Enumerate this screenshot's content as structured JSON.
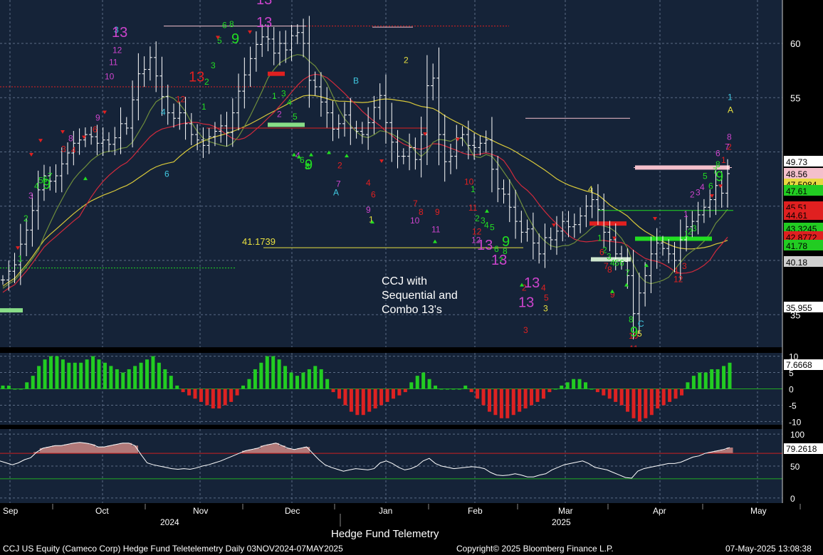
{
  "colors": {
    "panel_bg": "#152338",
    "grid": "#5a6b84",
    "bars": "#ffffff",
    "ma_short": "#6f8e3c",
    "ma_mid": "#d22a3c",
    "ma_long": "#d9c93a",
    "setup_green": "#22dd22",
    "setup_magenta": "#cc44cc",
    "count_red": "#e02020",
    "count_yellow": "#e8e040",
    "count_cyan": "#40c8e0",
    "hist_pos": "#22cc22",
    "hist_neg": "#dd2222",
    "rsi_line": "#ffffff",
    "rsi_fill": "#b07878",
    "rsi_upper": "#cc2020",
    "rsi_lower": "#22aa22"
  },
  "annotation": {
    "line1": "CCJ with",
    "line2": "Sequential and",
    "line3": "Combo 13's"
  },
  "footer": {
    "center_title": "Hedge Fund Telemetry",
    "left": "CCJ US Equity (Cameco Corp) Hedge Fund Teletelemetry  Daily 03NOV2024-07MAY2025",
    "copyright": "Copyright© 2025 Bloomberg Finance L.P.",
    "timestamp": "07-May-2025 13:08:38"
  },
  "chart_data": [
    {
      "type": "bar",
      "subtype": "ohlc",
      "ticker": "CCJ US Equity",
      "ylim": [
        32,
        64
      ],
      "yticks": [
        35,
        40,
        45,
        50,
        55,
        60
      ],
      "ytick_labels": [
        "35",
        "",
        "",
        "",
        "55",
        "60"
      ],
      "x_month_labels": [
        "Sep",
        "Oct",
        "Nov",
        "Dec",
        "Jan",
        "Feb",
        "Mar",
        "Apr",
        "May"
      ],
      "x_year_labels": [
        "2024",
        "2025"
      ],
      "close_series": [
        38.2,
        39.0,
        39.6,
        41.5,
        42.8,
        44.6,
        46.5,
        47.8,
        47.3,
        47.8,
        48.9,
        49.9,
        50.8,
        51.1,
        51.6,
        51.4,
        50.8,
        51.1,
        50.7,
        51.3,
        52.6,
        52.2,
        54.8,
        57.2,
        57.6,
        58.7,
        57.0,
        55.1,
        53.6,
        53.1,
        53.6,
        52.6,
        51.6,
        51.1,
        50.6,
        51.4,
        51.9,
        52.4,
        51.8,
        53.6,
        55.6,
        57.1,
        58.6,
        59.9,
        60.6,
        60.4,
        59.1,
        60.0,
        59.4,
        60.7,
        61.0,
        60.0,
        56.6,
        56.0,
        54.6,
        53.6,
        52.1,
        52.6,
        53.4,
        52.2,
        51.9,
        51.6,
        52.7,
        54.1,
        55.2,
        52.7,
        50.9,
        49.6,
        49.6,
        50.4,
        49.3,
        51.6,
        56.1,
        56.8,
        51.6,
        49.1,
        49.6,
        51.3,
        51.6,
        50.6,
        50.4,
        50.8,
        51.1,
        48.4,
        46.6,
        46.1,
        44.9,
        43.6,
        42.6,
        42.9,
        41.6,
        40.6,
        42.1,
        41.9,
        42.7,
        43.6,
        43.1,
        43.3,
        44.1,
        45.0,
        45.6,
        44.7,
        42.6,
        41.9,
        40.6,
        39.9,
        38.6,
        35.1,
        37.0,
        38.6,
        40.6,
        41.6,
        41.1,
        40.6,
        40.0,
        41.9,
        43.1,
        43.6,
        44.2,
        44.9,
        45.6,
        46.9,
        46.2,
        48.0
      ],
      "annotations": [
        {
          "text": "41.1739",
          "kind": "level_label",
          "value": 41.17
        },
        {
          "text": "13",
          "kind": "sequential_13",
          "where": "Nov peak"
        },
        {
          "text": "13",
          "kind": "sequential_13",
          "where": "Feb low"
        },
        {
          "text": "13",
          "kind": "combo_13",
          "where": "Feb low"
        },
        {
          "text": "9",
          "kind": "setup_9",
          "where": "Sep"
        },
        {
          "text": "9",
          "kind": "setup_9",
          "where": "Nov"
        },
        {
          "text": "9",
          "kind": "setup_9",
          "where": "Dec"
        },
        {
          "text": "9",
          "kind": "setup_9",
          "where": "Apr low"
        },
        {
          "text": "9",
          "kind": "setup_9",
          "where": "Apr high"
        },
        {
          "text": "11",
          "kind": "count_label",
          "where": "Apr low"
        },
        {
          "text": "12",
          "kind": "count_label",
          "where": "Apr"
        },
        {
          "text": "C",
          "kind": "letter_label",
          "where": "Apr low"
        },
        {
          "text": "A",
          "kind": "letter_label",
          "where": "Dec"
        },
        {
          "text": "B",
          "kind": "letter_label",
          "where": "Dec"
        },
        {
          "text": "A",
          "kind": "letter_label",
          "where": "May"
        }
      ],
      "right_labels": [
        {
          "value": "49.73",
          "color": "#ffffff"
        },
        {
          "value": "48.56",
          "color": "#f4c0cc"
        },
        {
          "value": "47.5084",
          "color": "#e8d840"
        },
        {
          "value": "47.61",
          "color": "#22cc22"
        },
        {
          "value": "45.51",
          "color": "#e02020"
        },
        {
          "value": "44.61",
          "color": "#e02020"
        },
        {
          "value": "43.3245",
          "color": "#22cc22"
        },
        {
          "value": "42.8772",
          "color": "#e02020"
        },
        {
          "value": "41.78",
          "color": "#22cc22"
        },
        {
          "value": "40.18",
          "color": "#d0d0d0"
        },
        {
          "value": "35.955",
          "color": "#ffffff"
        }
      ]
    },
    {
      "type": "bar",
      "subtype": "histogram",
      "ylim": [
        -11,
        11
      ],
      "yticks": [
        10,
        5,
        0,
        -5,
        -10
      ],
      "ytick_labels": [
        "10",
        "5",
        "0",
        "-5",
        "-10"
      ],
      "last_value_label": "7.6668",
      "values": [
        1,
        1,
        0,
        0,
        2,
        4,
        7,
        9,
        10,
        10,
        9,
        8,
        8,
        8,
        9,
        10,
        9,
        8,
        7,
        6,
        5,
        6,
        7,
        8,
        9,
        10,
        8,
        6,
        4,
        1,
        -1,
        -2,
        -3,
        -4,
        -5,
        -6,
        -6,
        -5,
        -4,
        -2,
        1,
        3,
        6,
        8,
        10,
        10,
        9,
        7,
        5,
        4,
        5,
        6,
        7,
        6,
        3,
        -1,
        -3,
        -5,
        -7,
        -8,
        -8,
        -7,
        -6,
        -5,
        -4,
        -3,
        -2,
        -1,
        2,
        4,
        5,
        3,
        1,
        0,
        0,
        0,
        0,
        1,
        -1,
        -3,
        -5,
        -7,
        -8,
        -9,
        -9,
        -8,
        -7,
        -6,
        -5,
        -4,
        -3,
        -1,
        0,
        1,
        2,
        3,
        3,
        2,
        0,
        -1,
        -2,
        -3,
        -4,
        -5,
        -7,
        -9,
        -10,
        -9,
        -8,
        -6,
        -5,
        -4,
        -3,
        -2,
        2,
        4,
        5,
        5,
        6,
        6,
        7,
        8
      ]
    },
    {
      "type": "line",
      "subtype": "oscillator",
      "ylim": [
        -8,
        108
      ],
      "yticks": [
        100,
        50,
        0
      ],
      "ytick_labels": [
        "100",
        "50",
        "0"
      ],
      "upper_level": 70,
      "lower_level": 30,
      "last_value_label": "79.2618",
      "values": [
        58,
        55,
        52,
        55,
        60,
        63,
        72,
        78,
        80,
        82,
        82,
        84,
        86,
        87,
        86,
        84,
        80,
        80,
        82,
        84,
        86,
        86,
        82,
        68,
        55,
        52,
        50,
        48,
        46,
        45,
        46,
        45,
        47,
        50,
        52,
        55,
        58,
        62,
        66,
        70,
        74,
        76,
        78,
        82,
        84,
        86,
        82,
        78,
        76,
        78,
        80,
        70,
        60,
        52,
        48,
        45,
        42,
        44,
        46,
        45,
        44,
        46,
        55,
        58,
        54,
        48,
        44,
        46,
        50,
        58,
        62,
        54,
        50,
        48,
        46,
        47,
        48,
        49,
        48,
        46,
        40,
        36,
        35,
        36,
        38,
        36,
        33,
        33,
        36,
        38,
        44,
        48,
        52,
        54,
        56,
        58,
        54,
        48,
        46,
        44,
        40,
        36,
        32,
        31,
        42,
        46,
        48,
        50,
        52,
        54,
        54,
        56,
        60,
        64,
        66,
        70,
        72,
        74,
        76,
        79
      ]
    }
  ]
}
